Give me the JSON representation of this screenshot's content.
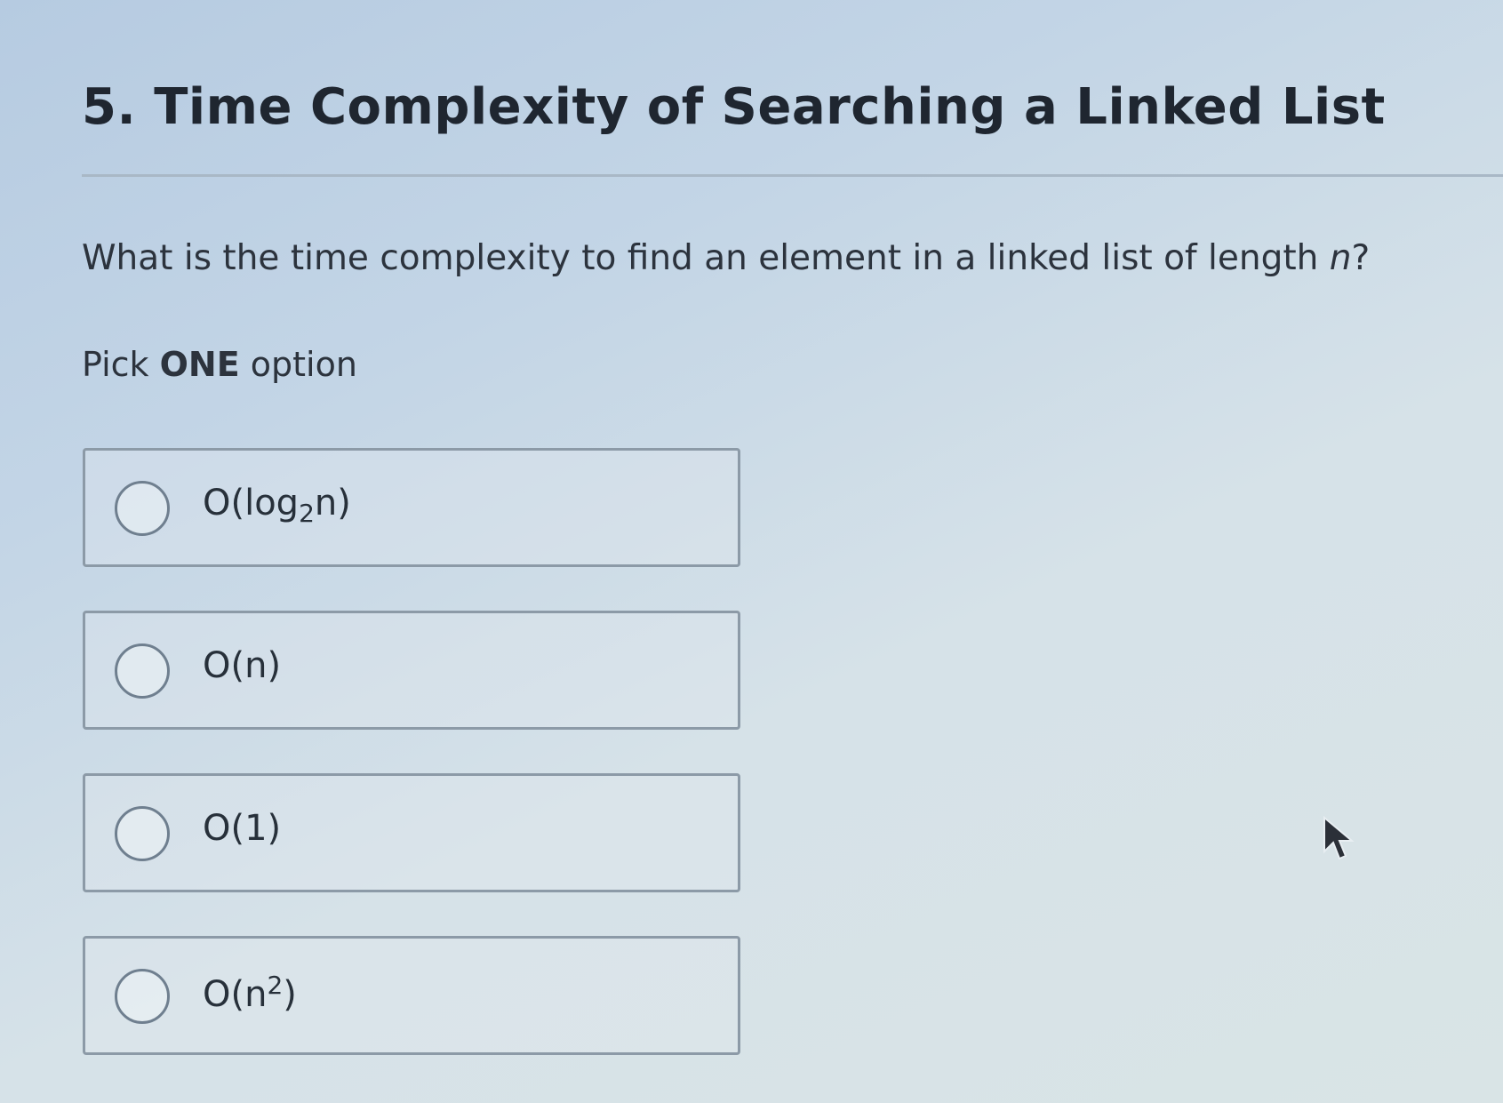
{
  "question": {
    "title": "5. Time Complexity of Searching a Linked List",
    "prompt_text": "What is the time complexity to find an element in a linked list of length ",
    "prompt_var": "n",
    "prompt_end": "?",
    "instruction_prefix": "Pick ",
    "instruction_bold": "ONE",
    "instruction_suffix": " option"
  },
  "options": [
    {
      "base": "O(log",
      "sub": "2",
      "after_sub": "n)",
      "selected": false
    },
    {
      "text": "O(n)",
      "selected": false
    },
    {
      "text": "O(1)",
      "selected": false
    },
    {
      "base": "O(n",
      "sup": "2",
      "after_sup": ")",
      "selected": false
    }
  ],
  "icons": {
    "radio": "radio-button-empty-icon",
    "cursor": "mouse-pointer-icon"
  },
  "colors": {
    "background": "#c3d5e6",
    "text": "#2a3340",
    "option_border": "#8c9aa7"
  }
}
